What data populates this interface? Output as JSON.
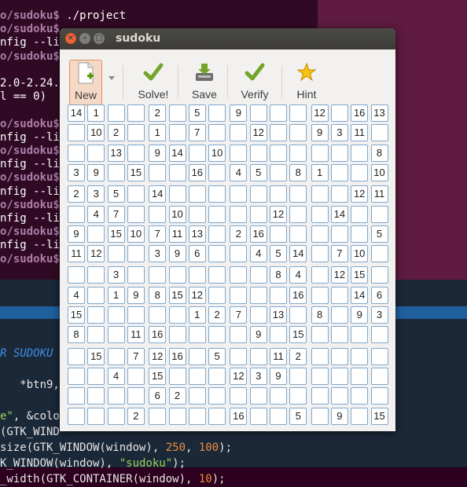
{
  "terminal": {
    "lines": [
      {
        "prompt": "o/sudoku$",
        "text": " ./project"
      },
      {
        "prompt": "o/sudoku$",
        "text": ""
      },
      {
        "prompt": "",
        "text": "nfig --li"
      },
      {
        "prompt": "o/sudoku$",
        "text": ""
      },
      {
        "prompt": "",
        "text": ""
      },
      {
        "prompt": "",
        "text": "2.0-2.24."
      },
      {
        "prompt": "",
        "text": "l == 0)"
      },
      {
        "prompt": "",
        "text": ""
      },
      {
        "prompt": "o/sudoku$",
        "text": ""
      },
      {
        "prompt": "",
        "text": "nfig --li"
      },
      {
        "prompt": "o/sudoku$",
        "text": ""
      },
      {
        "prompt": "",
        "text": "nfig --li"
      },
      {
        "prompt": "o/sudoku$",
        "text": ""
      },
      {
        "prompt": "",
        "text": "nfig --li"
      },
      {
        "prompt": "o/sudoku$",
        "text": ""
      },
      {
        "prompt": "",
        "text": "nfig --li"
      },
      {
        "prompt": "o/sudoku$",
        "text": ""
      },
      {
        "prompt": "",
        "text": "nfig --li"
      },
      {
        "prompt": "o/sudoku$",
        "text": ""
      }
    ]
  },
  "editor": {
    "lines": [
      {
        "parts": [
          {
            "t": "R SUDOKU",
            "c": "cmt"
          }
        ]
      },
      {
        "parts": [
          {
            "t": "",
            "c": ""
          }
        ]
      },
      {
        "parts": [
          {
            "t": "   *btn9,",
            "c": ""
          }
        ]
      },
      {
        "parts": [
          {
            "t": "",
            "c": ""
          }
        ]
      },
      {
        "parts": [
          {
            "t": "e\"",
            "c": "str"
          },
          {
            "t": ", &colo",
            "c": ""
          }
        ]
      },
      {
        "parts": [
          {
            "t": "(GTK_WIND",
            "c": ""
          }
        ]
      },
      {
        "parts": [
          {
            "t": "size(GTK_WINDOW(window), ",
            "c": ""
          },
          {
            "t": "250",
            "c": "num"
          },
          {
            "t": ", ",
            "c": ""
          },
          {
            "t": "100",
            "c": "num"
          },
          {
            "t": ");",
            "c": ""
          }
        ]
      },
      {
        "parts": [
          {
            "t": "K_WINDOW(window), ",
            "c": ""
          },
          {
            "t": "\"sudoku\"",
            "c": "str"
          },
          {
            "t": ");",
            "c": ""
          }
        ]
      },
      {
        "parts": [
          {
            "t": "_width(GTK_CONTAINER(window), ",
            "c": ""
          },
          {
            "t": "10",
            "c": "num"
          },
          {
            "t": ");",
            "c": ""
          }
        ]
      }
    ]
  },
  "window": {
    "title": "sudoku",
    "close_glyph": "×",
    "min_glyph": "–",
    "max_glyph": "□"
  },
  "toolbar": {
    "new_label": "New",
    "solve_label": "Solve!",
    "save_label": "Save",
    "verify_label": "Verify",
    "hint_label": "Hint",
    "accent": "#e08d5c"
  },
  "grid": {
    "size": 16,
    "rows": [
      [
        "14",
        "1",
        "",
        "",
        "2",
        "",
        "5",
        "",
        "9",
        "",
        "",
        "",
        "12",
        "",
        "16",
        "13"
      ],
      [
        "",
        "10",
        "2",
        "",
        "1",
        "",
        "7",
        "",
        "",
        "12",
        "",
        "",
        "9",
        "3",
        "11",
        ""
      ],
      [
        "",
        "",
        "13",
        "",
        "9",
        "14",
        "",
        "10",
        "",
        "",
        "",
        "",
        "",
        "",
        "",
        "8"
      ],
      [
        "3",
        "9",
        "",
        "15",
        "",
        "",
        "16",
        "",
        "4",
        "5",
        "",
        "8",
        "1",
        "",
        "",
        "10"
      ],
      [
        "2",
        "3",
        "5",
        "",
        "14",
        "",
        "",
        "",
        "",
        "",
        "",
        "",
        "",
        "",
        "12",
        "11"
      ],
      [
        "",
        "4",
        "7",
        "",
        "",
        "10",
        "",
        "",
        "",
        "",
        "12",
        "",
        "",
        "14",
        "",
        ""
      ],
      [
        "9",
        "",
        "15",
        "10",
        "7",
        "11",
        "13",
        "",
        "2",
        "16",
        "",
        "",
        "",
        "",
        "",
        "5"
      ],
      [
        "11",
        "12",
        "",
        "",
        "3",
        "9",
        "6",
        "",
        "",
        "4",
        "5",
        "14",
        "",
        "7",
        "10",
        ""
      ],
      [
        "",
        "",
        "3",
        "",
        "",
        "",
        "",
        "",
        "",
        "",
        "8",
        "4",
        "",
        "12",
        "15",
        ""
      ],
      [
        "4",
        "",
        "1",
        "9",
        "8",
        "15",
        "12",
        "",
        "",
        "",
        "",
        "16",
        "",
        "",
        "14",
        "6"
      ],
      [
        "15",
        "",
        "",
        "",
        "",
        "",
        "1",
        "2",
        "7",
        "",
        "13",
        "",
        "8",
        "",
        "9",
        "3"
      ],
      [
        "8",
        "",
        "",
        "11",
        "16",
        "",
        "",
        "",
        "",
        "9",
        "",
        "15",
        "",
        "",
        "",
        ""
      ],
      [
        "",
        "15",
        "",
        "7",
        "12",
        "16",
        "",
        "5",
        "",
        "",
        "11",
        "2",
        "",
        "",
        "",
        ""
      ],
      [
        "",
        "",
        "4",
        "",
        "15",
        "",
        "",
        "",
        "12",
        "3",
        "9",
        "",
        "",
        "",
        "",
        ""
      ],
      [
        "",
        "",
        "",
        "",
        "6",
        "2",
        "",
        "",
        "",
        "",
        "",
        "",
        "",
        "",
        "",
        ""
      ],
      [
        "",
        "",
        "",
        "2",
        "",
        "",
        "",
        "",
        "16",
        "",
        "",
        "5",
        "",
        "9",
        "",
        "15"
      ]
    ]
  }
}
